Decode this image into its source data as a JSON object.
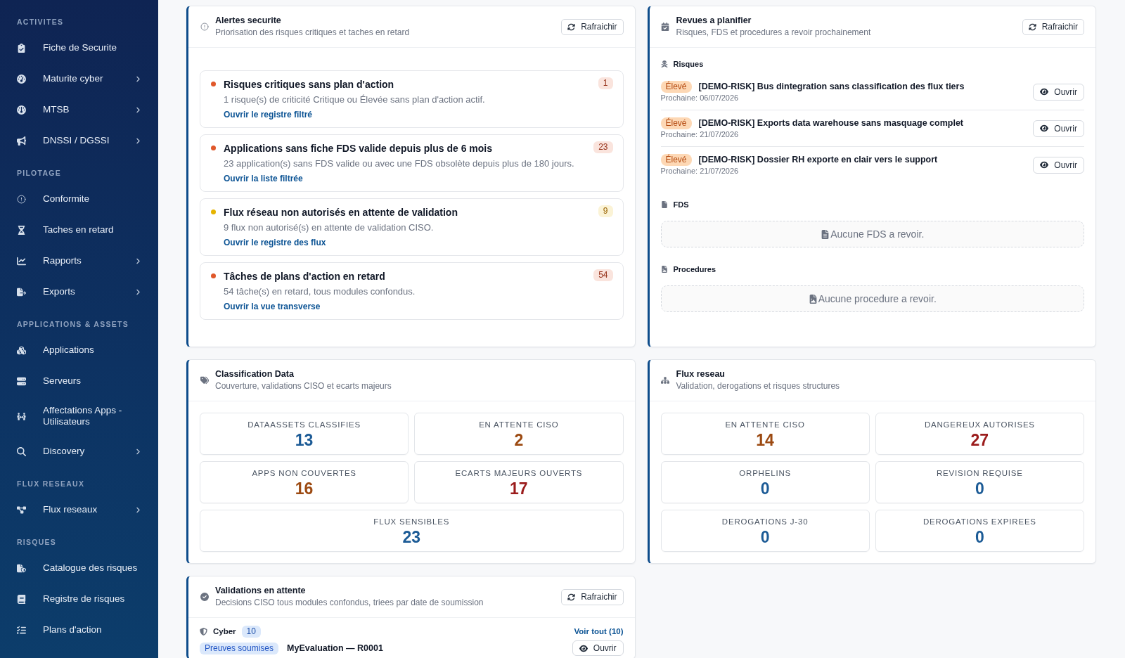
{
  "sidebar": {
    "sections": [
      {
        "label": "ACTIVITES",
        "items": [
          {
            "label": "Fiche de Securite",
            "expandable": false
          },
          {
            "label": "Maturite cyber",
            "expandable": true
          },
          {
            "label": "MTSB",
            "expandable": true
          },
          {
            "label": "DNSSI / DGSSI",
            "expandable": true
          }
        ]
      },
      {
        "label": "PILOTAGE",
        "items": [
          {
            "label": "Conformite",
            "expandable": false
          },
          {
            "label": "Taches en retard",
            "expandable": false
          },
          {
            "label": "Rapports",
            "expandable": true
          },
          {
            "label": "Exports",
            "expandable": true
          }
        ]
      },
      {
        "label": "APPLICATIONS & ASSETS",
        "items": [
          {
            "label": "Applications",
            "expandable": false
          },
          {
            "label": "Serveurs",
            "expandable": false
          },
          {
            "label": "Affectations Apps - Utilisateurs",
            "expandable": false
          },
          {
            "label": "Discovery",
            "expandable": true
          }
        ]
      },
      {
        "label": "FLUX RESEAUX",
        "items": [
          {
            "label": "Flux reseaux",
            "expandable": true
          }
        ]
      },
      {
        "label": "RISQUES",
        "items": [
          {
            "label": "Catalogue des risques",
            "expandable": false
          },
          {
            "label": "Registre de risques",
            "expandable": false
          },
          {
            "label": "Plans d'action",
            "expandable": false
          }
        ]
      }
    ]
  },
  "cards": [
    {
      "kind": "alerts",
      "title": "Alertes securite",
      "subtitle": "Priorisation des risques critiques et taches en retard",
      "refresh": "Rafraichir",
      "alerts": [
        {
          "color": "#e0582b",
          "title": "Risques critiques sans plan d'action",
          "count": "1",
          "description": "1 risque(s) de criticité Critique ou Élevée sans plan d'action actif.",
          "link": "Ouvrir le registre filtré"
        },
        {
          "color": "#e0582b",
          "title": "Applications sans fiche FDS valide depuis plus de 6 mois",
          "count": "23",
          "description": "23 application(s) sans FDS valide ou avec une FDS obsolète depuis plus de 180 jours.",
          "link": "Ouvrir la liste filtrée"
        },
        {
          "color": "#e6b400",
          "title": "Flux réseau non autorisés en attente de validation",
          "count": "9",
          "description": "9 flux non autorisé(s) en attente de validation CISO.",
          "link": "Ouvrir le registre des flux"
        },
        {
          "color": "#e0582b",
          "title": "Tâches de plans d'action en retard",
          "count": "54",
          "description": "54 tâche(s) en retard, tous modules confondus.",
          "link": "Ouvrir la vue transverse"
        }
      ]
    },
    {
      "kind": "reviews",
      "title": "Revues a planifier",
      "subtitle": "Risques, FDS et procedures a revoir prochainement",
      "refresh": "Rafraichir",
      "sections": [
        {
          "kind": "list",
          "heading": "Risques",
          "items": [
            {
              "badge": "Élevé",
              "title": "[DEMO-RISK] Bus dintegration sans classification des flux tiers",
              "date": "Prochaine: 06/07/2026",
              "button": "Ouvrir"
            },
            {
              "badge": "Élevé",
              "title": "[DEMO-RISK] Exports data warehouse sans masquage complet",
              "date": "Prochaine: 21/07/2026",
              "button": "Ouvrir"
            },
            {
              "badge": "Élevé",
              "title": "[DEMO-RISK] Dossier RH exporte en clair vers le support",
              "date": "Prochaine: 21/07/2026",
              "button": "Ouvrir"
            }
          ]
        },
        {
          "kind": "empty",
          "heading": "FDS",
          "empty": "Aucune FDS a revoir."
        },
        {
          "kind": "empty",
          "heading": "Procedures",
          "empty": "Aucune procedure a revoir."
        }
      ]
    },
    {
      "kind": "stats",
      "title": "Classification Data",
      "subtitle": "Couverture, validations CISO et ecarts majeurs",
      "stats": [
        {
          "label": "DATAASSETS CLASSIFIES",
          "value": "13",
          "color": "#1c5b96"
        },
        {
          "label": "EN ATTENTE CISO",
          "value": "2",
          "color": "#9c4a12"
        },
        {
          "label": "APPS NON COUVERTES",
          "value": "16",
          "color": "#9c4a12"
        },
        {
          "label": "ECARTS MAJEURS OUVERTS",
          "value": "17",
          "color": "#9b1c1c"
        },
        {
          "label": "FLUX SENSIBLES",
          "value": "23",
          "color": "#1c5b96"
        }
      ]
    },
    {
      "kind": "stats",
      "title": "Flux reseau",
      "subtitle": "Validation, derogations et risques structures",
      "stats": [
        {
          "label": "EN ATTENTE CISO",
          "value": "14",
          "color": "#9c4a12"
        },
        {
          "label": "DANGEREUX AUTORISES",
          "value": "27",
          "color": "#9b1c1c"
        },
        {
          "label": "ORPHELINS",
          "value": "0",
          "color": "#1c5b96"
        },
        {
          "label": "REVISION REQUISE",
          "value": "0",
          "color": "#1c5b96"
        },
        {
          "label": "DEROGATIONS J-30",
          "value": "0",
          "color": "#1c5b96"
        },
        {
          "label": "DEROGATIONS EXPIREES",
          "value": "0",
          "color": "#1c5b96"
        }
      ]
    },
    {
      "kind": "validations",
      "title": "Validations en attente",
      "subtitle": "Decisions CISO tous modules confondus, triees par date de soumission",
      "refresh": "Rafraichir",
      "groups": [
        {
          "label": "Cyber",
          "count": "10",
          "see_all": "Voir tout (10)",
          "items": [
            {
              "badge": "Preuves soumises",
              "title": "MyEvaluation — R0001",
              "button": "Ouvrir"
            }
          ]
        }
      ]
    }
  ]
}
